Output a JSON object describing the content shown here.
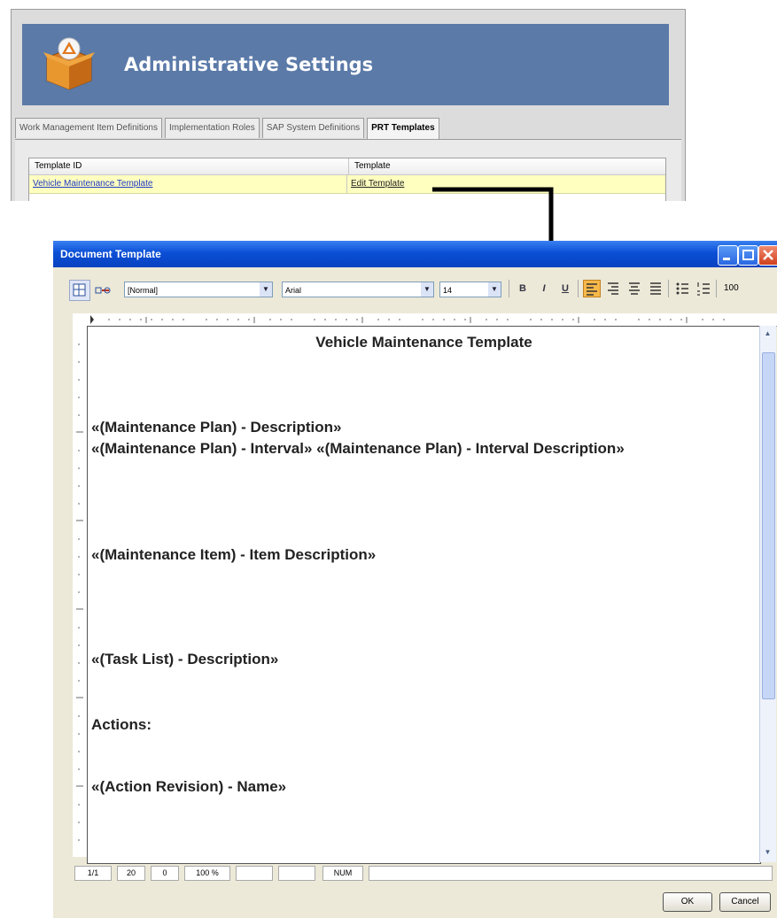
{
  "admin": {
    "title": "Administrative Settings",
    "tabs": [
      {
        "label": "Work Management Item Definitions"
      },
      {
        "label": "Implementation Roles"
      },
      {
        "label": "SAP System Definitions"
      },
      {
        "label": "PRT Templates",
        "active": true
      }
    ],
    "grid": {
      "headers": [
        "Template ID",
        "Template"
      ],
      "rows": [
        {
          "template_id": "Vehicle Maintenance Template",
          "template": "Edit Template"
        }
      ]
    }
  },
  "dialog": {
    "title": "Document Template",
    "toolbar": {
      "style_value": "[Normal]",
      "font_value": "Arial",
      "size_value": "14",
      "bold": "B",
      "italic": "I",
      "underline": "U",
      "zoom_partial": "100"
    },
    "document": {
      "title": "Vehicle Maintenance Template",
      "lines": [
        "«(Maintenance Plan) - Description»",
        "«(Maintenance Plan) - Interval» «(Maintenance Plan) - Interval Description»",
        "«(Maintenance Item) - Item Description»",
        "«(Task List) - Description»",
        "Actions:",
        "«(Action Revision) - Name»"
      ]
    },
    "status": {
      "page": "1/1",
      "line": "20",
      "col": "0",
      "zoom": "100 %",
      "num": "NUM"
    },
    "buttons": {
      "ok": "OK",
      "cancel": "Cancel"
    }
  },
  "colors": {
    "banner": "#5b7aa8",
    "titlebar": "#0a4fd6",
    "row_highlight": "#ffffc0",
    "link": "#1e3ac4"
  }
}
